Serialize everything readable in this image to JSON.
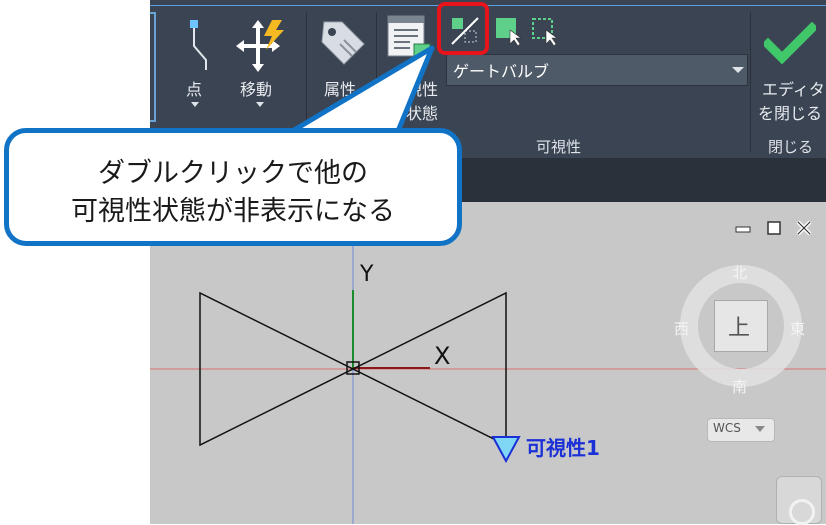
{
  "ribbon": {
    "point_label": "点",
    "move_label": "移動",
    "attribute_label": "属性",
    "visibility_state_label_1": "可視性",
    "visibility_state_label_2": "の状態",
    "dropdown_value": "ゲートバルブ",
    "visibility_panel_title": "可視性",
    "close_editor_label_1": "エディタ",
    "close_editor_label_2": "を閉じる",
    "close_panel_title": "閉じる"
  },
  "callout": {
    "line1": "ダブルクリックで他の",
    "line2": "可視性状態が非表示になる"
  },
  "canvas": {
    "y_axis_label": "Y",
    "x_axis_label": "X",
    "visibility_param_label": "可視性1"
  },
  "viewcube": {
    "north": "北",
    "south": "南",
    "east": "東",
    "west": "西",
    "top_face": "上",
    "wcs_label": "WCS"
  },
  "colors": {
    "ribbon_bg": "#3b4452",
    "callout_border": "#1173c6",
    "highlight": "#e8141c",
    "param_blue": "#1a2fd6",
    "grip_cyan": "#7fd6f5"
  }
}
